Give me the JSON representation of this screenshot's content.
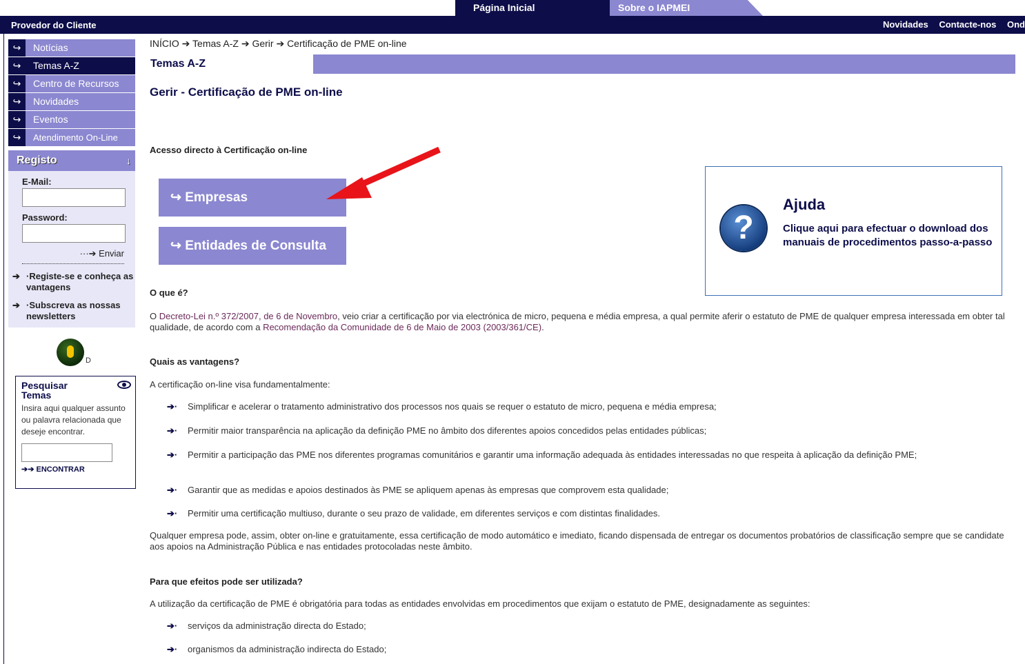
{
  "tabs": {
    "home": "Página Inicial",
    "about": "Sobre o IAPMEI"
  },
  "topbar": {
    "left": "Provedor do Cliente",
    "links": [
      "Novidades",
      "Contacte-nos",
      "Ond"
    ]
  },
  "nav": [
    {
      "label": "Notícias"
    },
    {
      "label": "Temas A-Z"
    },
    {
      "label": "Centro de Recursos"
    },
    {
      "label": "Novidades"
    },
    {
      "label": "Eventos"
    },
    {
      "label": "Atendimento On-Line"
    }
  ],
  "registo": {
    "title": "Registo",
    "email_label": "E-Mail:",
    "password_label": "Password:",
    "enviar": "···➔ Enviar",
    "links": [
      "·Registe-se e conheça as vantagens",
      "·Subscreva as nossas newsletters"
    ]
  },
  "padlock_letter": "D",
  "pesquisar": {
    "title": "Pesquisar Temas",
    "desc": "Insira aqui qualquer assunto ou palavra relacionada que deseje encontrar.",
    "button": "➔➔ ENCONTRAR"
  },
  "breadcrumb": "INÍCIO ➔ Temas A-Z ➔ Gerir ➔ Certificação de PME on-line",
  "section_header": "Temas A-Z",
  "page_title": "Gerir - Certificação de PME on-line",
  "acesso": "Acesso directo à Certificação on-line",
  "buttons": {
    "empresas": "↪ Empresas",
    "entidades": "↪ Entidades de Consulta"
  },
  "ajuda": {
    "title": "Ajuda",
    "text": "Clique aqui para efectuar o download dos manuais de procedimentos passo-a-passo"
  },
  "oque": {
    "heading": "O que é?",
    "link1": "Decreto-Lei n.º 372/2007, de 6 de Novembro",
    "pre1": "O ",
    "mid": ", veio criar a certificação por via electrónica de micro, pequena e média empresa, a qual permite aferir o estatuto de PME de qualquer empresa interessada em obter tal qualidade, de acordo com a ",
    "link2": "Recomendação da Comunidade de 6 de Maio de 2003 (2003/361/CE)",
    "post": "."
  },
  "vantagens": {
    "heading": "Quais as vantagens?",
    "intro": "A certificação on-line visa fundamentalmente:",
    "items": [
      "Simplificar e acelerar o tratamento administrativo dos processos nos quais se requer o estatuto de micro, pequena e média empresa;",
      "Permitir maior transparência na aplicação da definição PME no âmbito dos diferentes apoios concedidos pelas entidades públicas;",
      "Permitir a participação das PME nos diferentes programas comunitários e garantir uma informação adequada às entidades interessadas no que respeita à aplicação da definição PME;",
      "Garantir que as medidas e apoios destinados às PME se apliquem apenas às empresas que comprovem esta qualidade;",
      "Permitir uma certificação multiuso, durante o seu prazo de validade, em diferentes serviços e com distintas finalidades."
    ],
    "outro": "Qualquer empresa pode, assim, obter on-line e gratuitamente, essa certificação de modo automático e imediato, ficando dispensada de entregar os documentos probatórios de classificação sempre que se candidate aos apoios na Administração Pública e nas entidades protocoladas neste âmbito."
  },
  "efeitos": {
    "heading": "Para que efeitos pode ser utilizada?",
    "intro": "A utilização da certificação de PME é obrigatória para todas as entidades envolvidas em procedimentos que exijam o estatuto de PME, designadamente as seguintes:",
    "items": [
      "serviços da administração directa do Estado;",
      "organismos da administração indirecta do Estado;"
    ]
  },
  "bullet_glyph": "➔·",
  "colors": {
    "navy": "#0d0d4a",
    "lavender": "#8b87d0",
    "annotation_arrow": "#e8141a"
  }
}
